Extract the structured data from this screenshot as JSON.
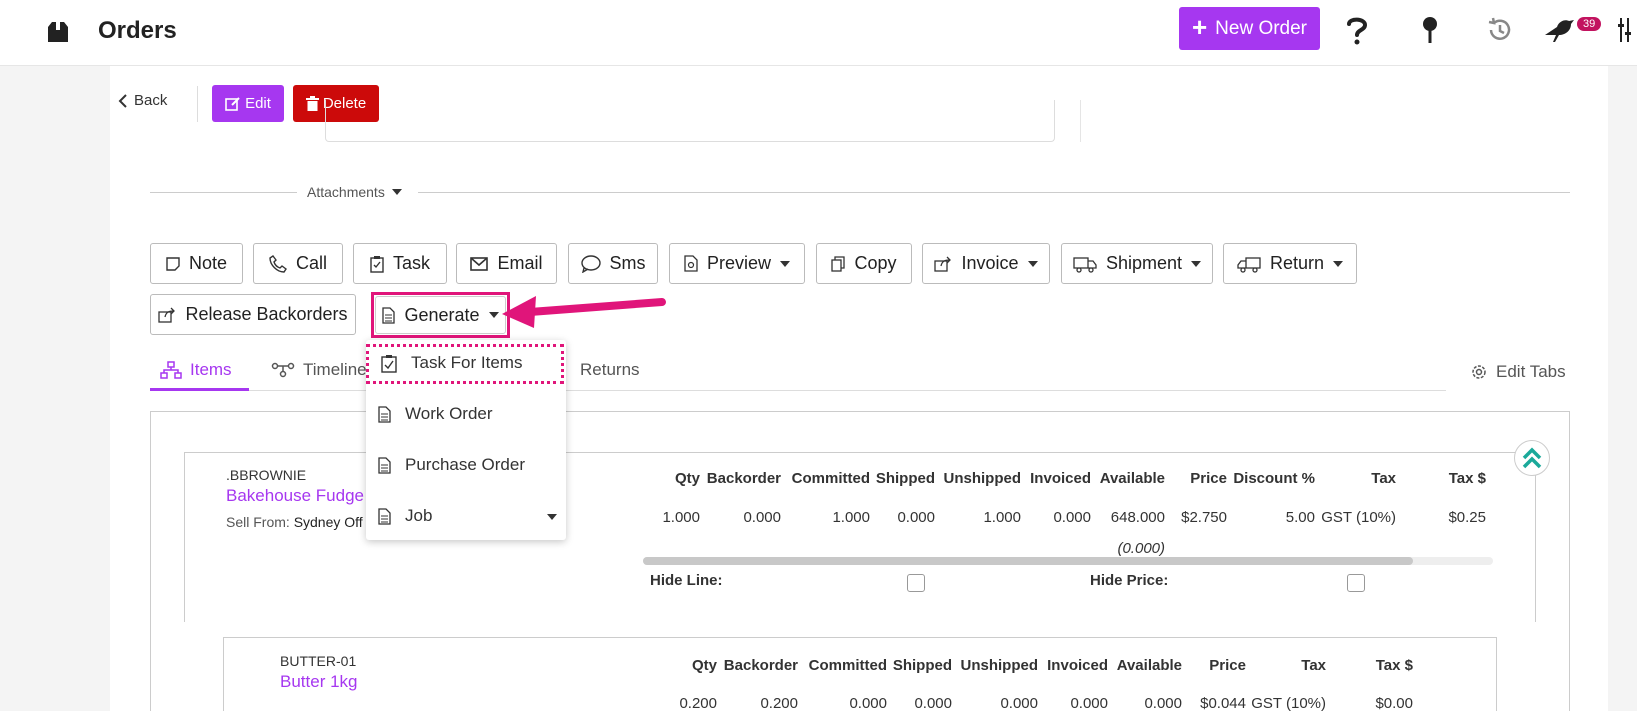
{
  "header": {
    "title": "Orders",
    "new_order_label": "New Order",
    "notification_count": "39"
  },
  "toolbar": {
    "back_label": "Back",
    "edit_label": "Edit",
    "delete_label": "Delete"
  },
  "attachments_label": "Attachments",
  "actions": {
    "note": "Note",
    "call": "Call",
    "task": "Task",
    "email": "Email",
    "sms": "Sms",
    "preview": "Preview",
    "copy": "Copy",
    "invoice": "Invoice",
    "shipment": "Shipment",
    "return": "Return",
    "release_backorders": "Release Backorders",
    "generate": "Generate"
  },
  "generate_menu": {
    "items": [
      "Task For Items",
      "Work Order",
      "Purchase Order",
      "Job"
    ]
  },
  "tabs": {
    "items": "Items",
    "timeline": "Timeline",
    "returns": "Returns",
    "edit_tabs": "Edit Tabs"
  },
  "line_items": [
    {
      "sku": ".BBROWNIE",
      "name": "Bakehouse Fudge B",
      "sell_from_label": "Sell From:",
      "sell_from_value": "Sydney Off",
      "headers": [
        "Qty",
        "Backorder",
        "Committed",
        "Shipped",
        "Unshipped",
        "Invoiced",
        "Available",
        "Price",
        "Discount %",
        "Tax",
        "Tax $"
      ],
      "values": [
        "1.000",
        "0.000",
        "1.000",
        "0.000",
        "1.000",
        "0.000",
        "648.000",
        "$2.750",
        "5.00",
        "GST (10%)",
        "$0.25"
      ],
      "available_sub": "(0.000)",
      "hide_line_label": "Hide Line:",
      "hide_price_label": "Hide Price:"
    },
    {
      "sku": "BUTTER-01",
      "name": "Butter 1kg",
      "headers": [
        "Qty",
        "Backorder",
        "Committed",
        "Shipped",
        "Unshipped",
        "Invoiced",
        "Available",
        "Price",
        "Tax",
        "Tax $"
      ],
      "values": [
        "0.200",
        "0.200",
        "0.000",
        "0.000",
        "0.000",
        "0.000",
        "0.000",
        "$0.044",
        "GST (10%)",
        "$0.00"
      ]
    }
  ],
  "colors": {
    "accent": "#a637f0",
    "danger": "#cc0a0a",
    "highlight": "#e0157a",
    "badge": "#c2135f"
  }
}
